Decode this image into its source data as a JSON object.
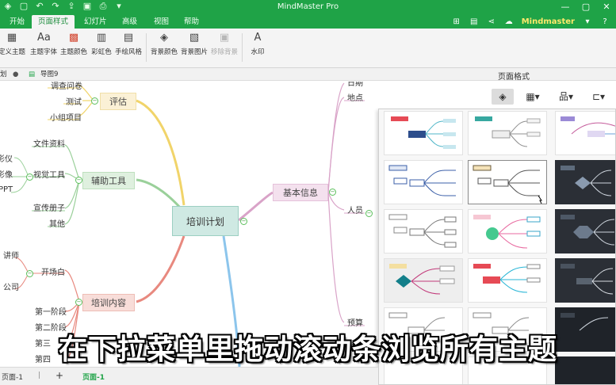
{
  "app": {
    "title": "MindMaster Pro",
    "user": "Mindmaster",
    "accent": "#1fa347"
  },
  "titlebar_icons": [
    "app-logo-icon",
    "save-icon",
    "undo-icon",
    "redo-icon",
    "export-icon",
    "open-icon",
    "print-icon",
    "more-icon"
  ],
  "window_buttons": [
    "minimize-icon",
    "maximize-icon",
    "close-icon"
  ],
  "menu": {
    "tabs": [
      "开始",
      "页面样式",
      "幻灯片",
      "高级",
      "视图",
      "帮助"
    ],
    "active": "页面样式"
  },
  "ribbon": {
    "buttons": [
      {
        "label": "定义主题",
        "icon": "theme-icon"
      },
      {
        "label": "主题字体",
        "icon": "font-icon"
      },
      {
        "label": "主题颜色",
        "icon": "color-palette-icon"
      },
      {
        "label": "彩虹色",
        "icon": "rainbow-icon"
      },
      {
        "label": "手绘风格",
        "icon": "hand-drawn-icon"
      },
      {
        "label": "背景颜色",
        "icon": "fill-bucket-icon"
      },
      {
        "label": "背景图片",
        "icon": "image-icon"
      },
      {
        "label": "移除背景",
        "icon": "remove-background-icon",
        "disabled": true
      },
      {
        "label": "水印",
        "icon": "watermark-icon"
      }
    ]
  },
  "doctabs": {
    "left_fragment": "划",
    "tab": "导图9"
  },
  "right_panel": {
    "title": "页面格式"
  },
  "mindmap": {
    "central": "培训计划",
    "branches": [
      {
        "label": "评估",
        "children": [
          "调查问卷",
          "测试",
          "小组项目"
        ]
      },
      {
        "label": "辅助工具",
        "children": [
          "文件资料",
          "视觉工具",
          "宣传册子",
          "其他"
        ],
        "subchildren": [
          "影仪",
          "影像",
          "PPT"
        ]
      },
      {
        "label": "培训内容",
        "children": [
          "开场白",
          "第一阶段",
          "第二阶段",
          "第三",
          "第四"
        ],
        "subchildren": [
          "讲师",
          "公司"
        ]
      },
      {
        "label": "基本信息",
        "children": [
          "日期",
          "地点",
          "人员",
          "预算"
        ]
      }
    ]
  },
  "subtitle": "在下拉菜单里拖动滚动条浏览所有主题",
  "statusbar": {
    "page_left": "页面-1",
    "add": "+",
    "page_active": "页面-1"
  }
}
